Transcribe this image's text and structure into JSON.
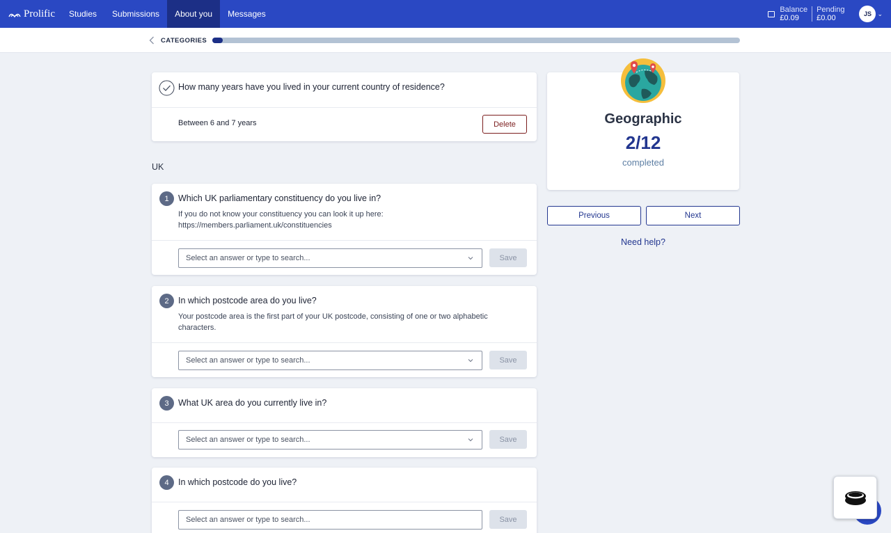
{
  "app": {
    "logo_text": "Prolific",
    "nav": [
      {
        "label": "Studies",
        "active": false
      },
      {
        "label": "Submissions",
        "active": false
      },
      {
        "label": "About you",
        "active": true
      },
      {
        "label": "Messages",
        "active": false
      }
    ],
    "balance_label": "Balance",
    "balance_value": "£0.09",
    "pending_label": "Pending",
    "pending_value": "£0.00",
    "avatar_initials": "JS"
  },
  "subheader": {
    "back_label": "CATEGORIES",
    "progress_fraction": 0.02
  },
  "answered_question": {
    "title": "How many years have you lived in your current country of residence?",
    "answer": "Between 6 and 7 years",
    "delete_label": "Delete"
  },
  "section_label": "UK",
  "questions": [
    {
      "number": "1",
      "title": "Which UK parliamentary constituency do you live in?",
      "help": "If you do not know your constituency you can look it up here: https://members.parliament.uk/constituencies",
      "placeholder": "Select an answer or type to search...",
      "save_label": "Save"
    },
    {
      "number": "2",
      "title": "In which postcode area do you live?",
      "help": "Your postcode area is the first part of your UK postcode, consisting of one or two alphabetic characters.",
      "placeholder": "Select an answer or type to search...",
      "save_label": "Save"
    },
    {
      "number": "3",
      "title": "What UK area do you currently live in?",
      "help": "",
      "placeholder": "Select an answer or type to search...",
      "save_label": "Save"
    },
    {
      "number": "4",
      "title": "In which postcode do you live?",
      "help": "",
      "placeholder": "Select an answer or type to search...",
      "save_label": "Save"
    }
  ],
  "category": {
    "icon": "globe-icon",
    "name": "Geographic",
    "count": "2/12",
    "status": "completed"
  },
  "buttons": {
    "previous": "Previous",
    "next": "Next",
    "help": "Need help?"
  },
  "colors": {
    "brand": "#2a48c3",
    "brand_dark": "#1c2f86",
    "delete": "#7b1d1d"
  }
}
